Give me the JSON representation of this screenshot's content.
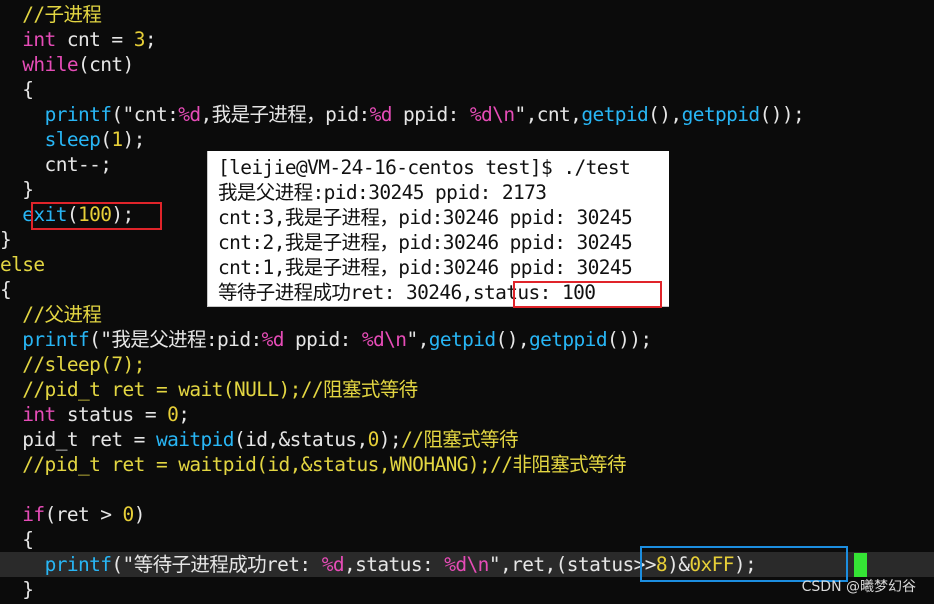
{
  "code": {
    "l1": "  //子进程",
    "l2a": "  ",
    "l2kw": "int",
    "l2b": " cnt = ",
    "l2num": "3",
    "l2c": ";",
    "l3a": "  ",
    "l3kw": "while",
    "l3b": "(cnt)",
    "l4": "  {",
    "l5a": "    ",
    "l5fn": "printf",
    "l5b": "(\"",
    "l5s1": "cnt:",
    "l5f1": "%d",
    "l5s2": ",我是子进程，pid:",
    "l5f2": "%d",
    "l5s3": " ppid: ",
    "l5f3": "%d\\n",
    "l5s4": "\",cnt,",
    "l5fn2": "getpid",
    "l5c": "(),",
    "l5fn3": "getppid",
    "l5d": "());",
    "l6a": "    ",
    "l6fn": "sleep",
    "l6b": "(",
    "l6num": "1",
    "l6c": ");",
    "l7": "    cnt--;",
    "l8": "  }",
    "l9a": "  ",
    "l9fn": "exit",
    "l9b": "(",
    "l9num": "100",
    "l9c": ");",
    "l10": "}",
    "l11": "else",
    "l12": "{",
    "l13": "  //父进程",
    "l14a": "  ",
    "l14fn": "printf",
    "l14b": "(\"",
    "l14s1": "我是父进程:pid:",
    "l14f1": "%d",
    "l14s2": " ppid: ",
    "l14f2": "%d\\n",
    "l14s3": "\",",
    "l14fn2": "getpid",
    "l14c": "(),",
    "l14fn3": "getppid",
    "l14d": "());",
    "l15": "  //sleep(7);",
    "l16": "  //pid_t ret = wait(NULL);//阻塞式等待",
    "l17a": "  ",
    "l17kw": "int",
    "l17b": " status = ",
    "l17num": "0",
    "l17c": ";",
    "l18a": "  pid_t ret = ",
    "l18fn": "waitpid",
    "l18b": "(id,&status,",
    "l18num": "0",
    "l18c": ");",
    "l18com": "//阻塞式等待",
    "l19": "  //pid_t ret = waitpid(id,&status,WNOHANG);//非阻塞式等待",
    "l20": "",
    "l21a": "  ",
    "l21kw": "if",
    "l21b": "(ret > ",
    "l21num": "0",
    "l21c": ")",
    "l22": "  {",
    "l23a": "    ",
    "l23fn": "printf",
    "l23b": "(\"",
    "l23s1": "等待子进程成功ret: ",
    "l23f1": "%d",
    "l23s2": ",status: ",
    "l23f2": "%d\\n",
    "l23s3": "\",ret,",
    "l23c": "(status>>",
    "l23num": "8",
    "l23d": ")&",
    "l23num2": "0xFF",
    "l23e": ");",
    "l24": "  }"
  },
  "terminal": {
    "t1": "[leijie@VM-24-16-centos test]$ ./test",
    "t2": "我是父进程:pid:30245 ppid: 2173",
    "t3": "cnt:3,我是子进程，pid:30246 ppid: 30245",
    "t4": "cnt:2,我是子进程，pid:30246 ppid: 30245",
    "t5": "cnt:1,我是子进程，pid:30246 ppid: 30245",
    "t6a": "等待子进程成功ret: 30246,",
    "t6b": "status: 100"
  },
  "watermark": "CSDN @曦梦幻谷",
  "colors": {
    "keyword": "#e64cb7",
    "function": "#28b6f5",
    "number": "#e7cf38",
    "comment": "#e3d642",
    "highlight_red": "#e0242a",
    "highlight_blue": "#1c8ee0",
    "cursor": "#35e435"
  }
}
